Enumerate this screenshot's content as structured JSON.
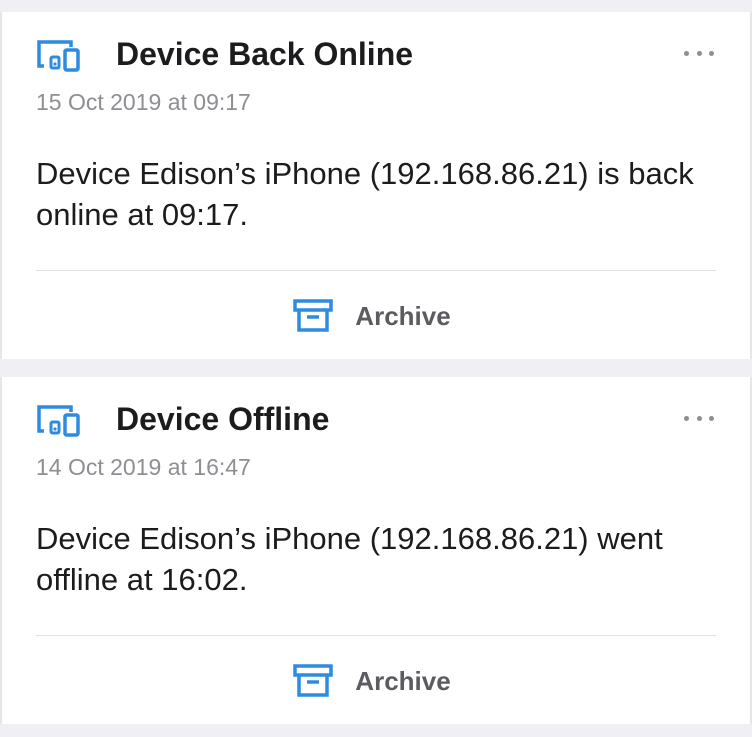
{
  "accent_color": "#2d8ce0",
  "notifications": [
    {
      "icon": "devices-icon",
      "title": "Device Back Online",
      "timestamp": "15 Oct 2019 at 09:17",
      "message": "Device Edison’s iPhone (192.168.86.21) is back online at 09:17.",
      "action_label": "Archive",
      "action_icon": "archive-icon",
      "more_icon": "more-icon"
    },
    {
      "icon": "devices-icon",
      "title": "Device Offline",
      "timestamp": "14 Oct 2019 at 16:47",
      "message": "Device Edison’s iPhone (192.168.86.21) went offline at 16:02.",
      "action_label": "Archive",
      "action_icon": "archive-icon",
      "more_icon": "more-icon"
    }
  ]
}
